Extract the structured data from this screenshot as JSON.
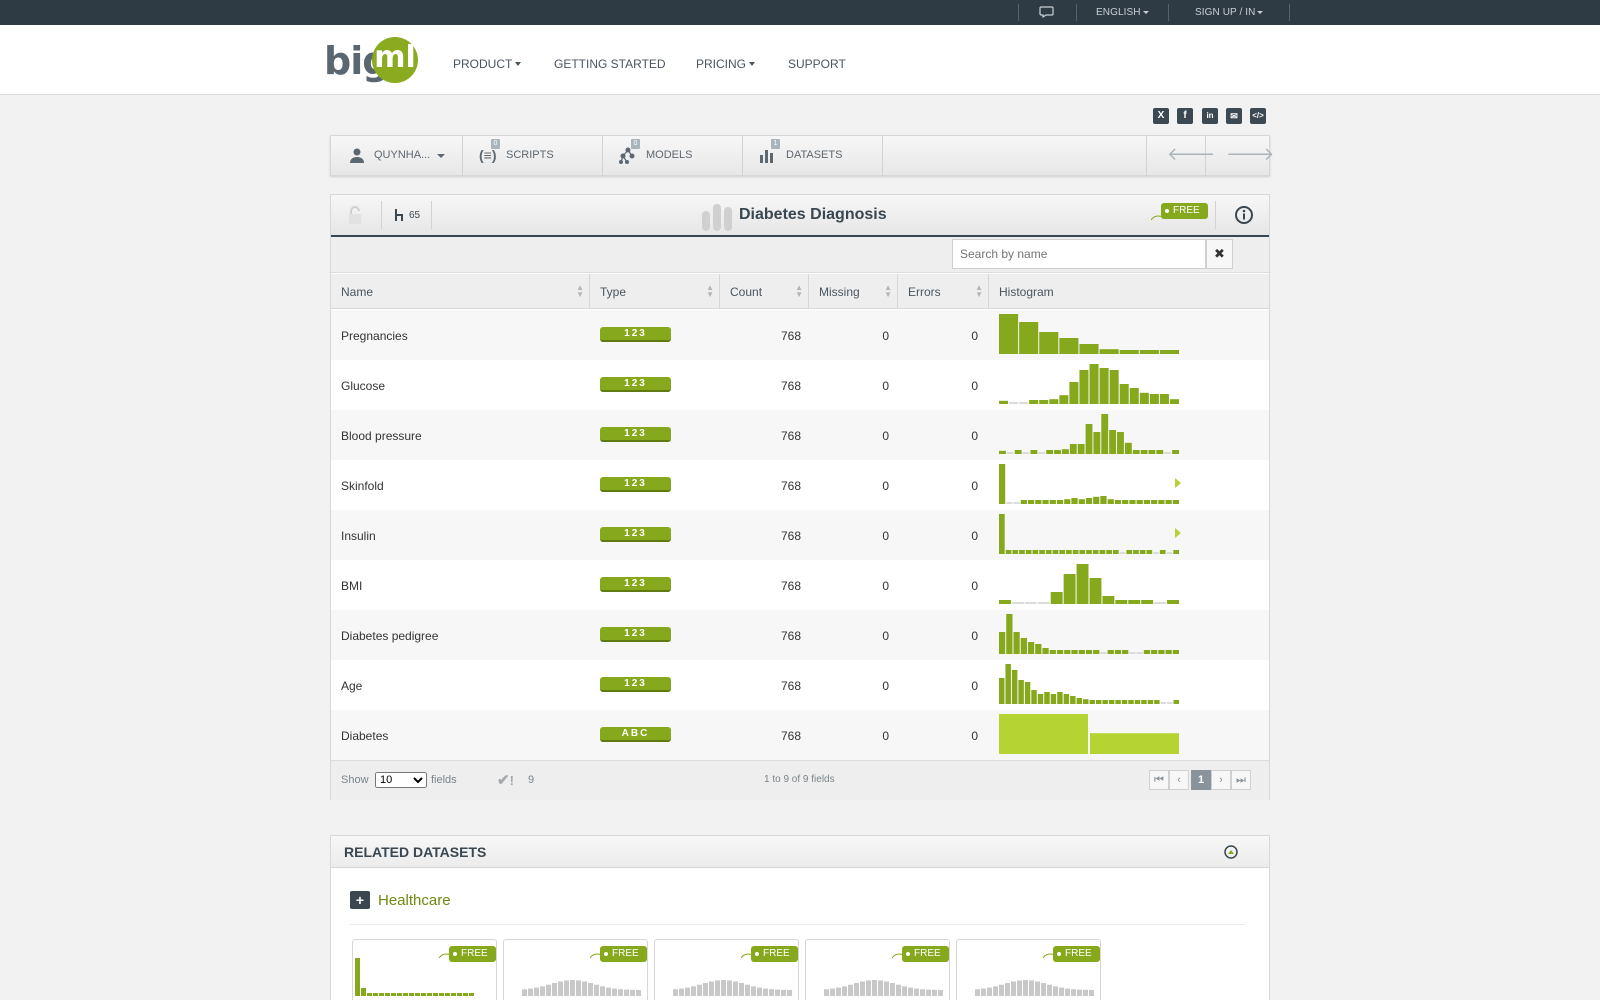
{
  "topbar": {
    "language": "ENGLISH",
    "signup": "SIGN UP / IN"
  },
  "logo": {
    "big": "big",
    "ml": "ml"
  },
  "nav": {
    "product": "PRODUCT",
    "getting_started": "GETTING STARTED",
    "pricing": "PRICING",
    "support": "SUPPORT"
  },
  "social": [
    "x",
    "f",
    "in",
    "mail",
    "embed"
  ],
  "breadcrumbs": {
    "user": "QUYNHA...",
    "scripts": {
      "label": "SCRIPTS",
      "count": "0"
    },
    "models": {
      "label": "MODELS",
      "count": "0"
    },
    "datasets": {
      "label": "DATASETS",
      "count": "1"
    }
  },
  "dataset": {
    "title": "Diabetes Diagnosis",
    "clones": "65",
    "badge": "FREE",
    "search_placeholder": "Search by name"
  },
  "table": {
    "headers": [
      "Name",
      "Type",
      "Count",
      "Missing",
      "Errors",
      "Histogram"
    ],
    "rows": [
      {
        "name": "Pregnancies",
        "type": "123",
        "count": "768",
        "missing": "0",
        "errors": "0"
      },
      {
        "name": "Glucose",
        "type": "123",
        "count": "768",
        "missing": "0",
        "errors": "0"
      },
      {
        "name": "Blood pressure",
        "type": "123",
        "count": "768",
        "missing": "0",
        "errors": "0"
      },
      {
        "name": "Skinfold",
        "type": "123",
        "count": "768",
        "missing": "0",
        "errors": "0"
      },
      {
        "name": "Insulin",
        "type": "123",
        "count": "768",
        "missing": "0",
        "errors": "0"
      },
      {
        "name": "BMI",
        "type": "123",
        "count": "768",
        "missing": "0",
        "errors": "0"
      },
      {
        "name": "Diabetes pedigree",
        "type": "123",
        "count": "768",
        "missing": "0",
        "errors": "0"
      },
      {
        "name": "Age",
        "type": "123",
        "count": "768",
        "missing": "0",
        "errors": "0"
      },
      {
        "name": "Diabetes",
        "type": "ABC",
        "count": "768",
        "missing": "0",
        "errors": "0"
      }
    ],
    "histograms": [
      [
        1.0,
        0.8,
        0.55,
        0.4,
        0.25,
        0.12,
        0.1,
        0.1,
        0.1
      ],
      [
        0.08,
        0.05,
        0.05,
        0.1,
        0.1,
        0.12,
        0.22,
        0.55,
        0.85,
        1.0,
        0.9,
        0.85,
        0.5,
        0.4,
        0.28,
        0.25,
        0.25,
        0.12
      ],
      [
        0.08,
        0.05,
        0.1,
        0.05,
        0.1,
        0.05,
        0.1,
        0.1,
        0.12,
        0.25,
        0.25,
        0.75,
        0.55,
        1.0,
        0.6,
        0.55,
        0.28,
        0.1,
        0.1,
        0.1,
        0.1,
        0.05,
        0.1
      ],
      [
        1.0,
        0.05,
        0.05,
        0.1,
        0.1,
        0.1,
        0.1,
        0.1,
        0.1,
        0.12,
        0.15,
        0.12,
        0.15,
        0.18,
        0.2,
        0.12,
        0.1,
        0.1,
        0.1,
        0.1,
        0.1,
        0.1,
        0.1,
        0.1,
        0.1
      ],
      [
        1.0,
        0.1,
        0.1,
        0.1,
        0.1,
        0.1,
        0.1,
        0.1,
        0.1,
        0.1,
        0.1,
        0.1,
        0.1,
        0.1,
        0.1,
        0.1,
        0.1,
        0.1,
        0.05,
        0.1,
        0.1,
        0.1,
        0.1,
        0.05,
        0.1,
        0.05,
        0.1
      ],
      [
        0.1,
        0.05,
        0.05,
        0.05,
        0.3,
        0.75,
        1.0,
        0.65,
        0.2,
        0.1,
        0.1,
        0.1,
        0.05,
        0.1
      ],
      [
        0.55,
        1.0,
        0.55,
        0.4,
        0.3,
        0.25,
        0.15,
        0.1,
        0.1,
        0.1,
        0.1,
        0.1,
        0.1,
        0.1,
        0.05,
        0.1,
        0.1,
        0.1,
        0.05,
        0.05,
        0.1,
        0.1,
        0.1,
        0.1,
        0.1
      ],
      [
        0.65,
        1.0,
        0.85,
        0.6,
        0.55,
        0.35,
        0.25,
        0.3,
        0.25,
        0.3,
        0.25,
        0.2,
        0.15,
        0.12,
        0.1,
        0.1,
        0.1,
        0.1,
        0.1,
        0.1,
        0.1,
        0.1,
        0.1,
        0.1,
        0.1,
        0.05,
        0.05,
        0.1
      ],
      [
        1.0,
        0.52
      ]
    ],
    "show_label": "Show",
    "show_value": "10",
    "fields_label": "fields",
    "errors_count": "9",
    "range_text": "1 to 9 of 9 fields",
    "page": "1"
  },
  "related": {
    "title": "RELATED DATASETS",
    "category": "Healthcare",
    "card_badge": "FREE",
    "cards": 5
  },
  "colors": {
    "accent": "#86a81c",
    "dark": "#2e3b45",
    "light_bar": "#b6d334",
    "missing_bar": "#dcdcdc"
  }
}
